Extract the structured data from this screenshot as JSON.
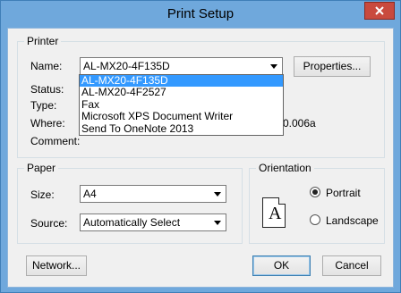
{
  "window": {
    "title": "Print Setup"
  },
  "printer": {
    "group_label": "Printer",
    "name_label": "Name:",
    "name_value": "AL-MX20-4F135D",
    "properties_button": "Properties...",
    "status_label": "Status:",
    "type_label": "Type:",
    "where_label": "Where:",
    "where_value_fragment": "0.006a",
    "comment_label": "Comment:",
    "dropdown_options": [
      "AL-MX20-4F135D",
      "AL-MX20-4F2527",
      "Fax",
      "Microsoft XPS Document Writer",
      "Send To OneNote 2013"
    ]
  },
  "paper": {
    "group_label": "Paper",
    "size_label": "Size:",
    "size_value": "A4",
    "source_label": "Source:",
    "source_value": "Automatically Select"
  },
  "orientation": {
    "group_label": "Orientation",
    "icon_letter": "A",
    "portrait_label": "Portrait",
    "landscape_label": "Landscape",
    "selected": "Portrait"
  },
  "footer": {
    "network_button": "Network...",
    "ok_button": "OK",
    "cancel_button": "Cancel"
  },
  "colors": {
    "title_bar": "#6fa8dc",
    "close_button": "#c94a3e",
    "selection": "#3399ff",
    "dialog_bg": "#f0f0f0"
  }
}
